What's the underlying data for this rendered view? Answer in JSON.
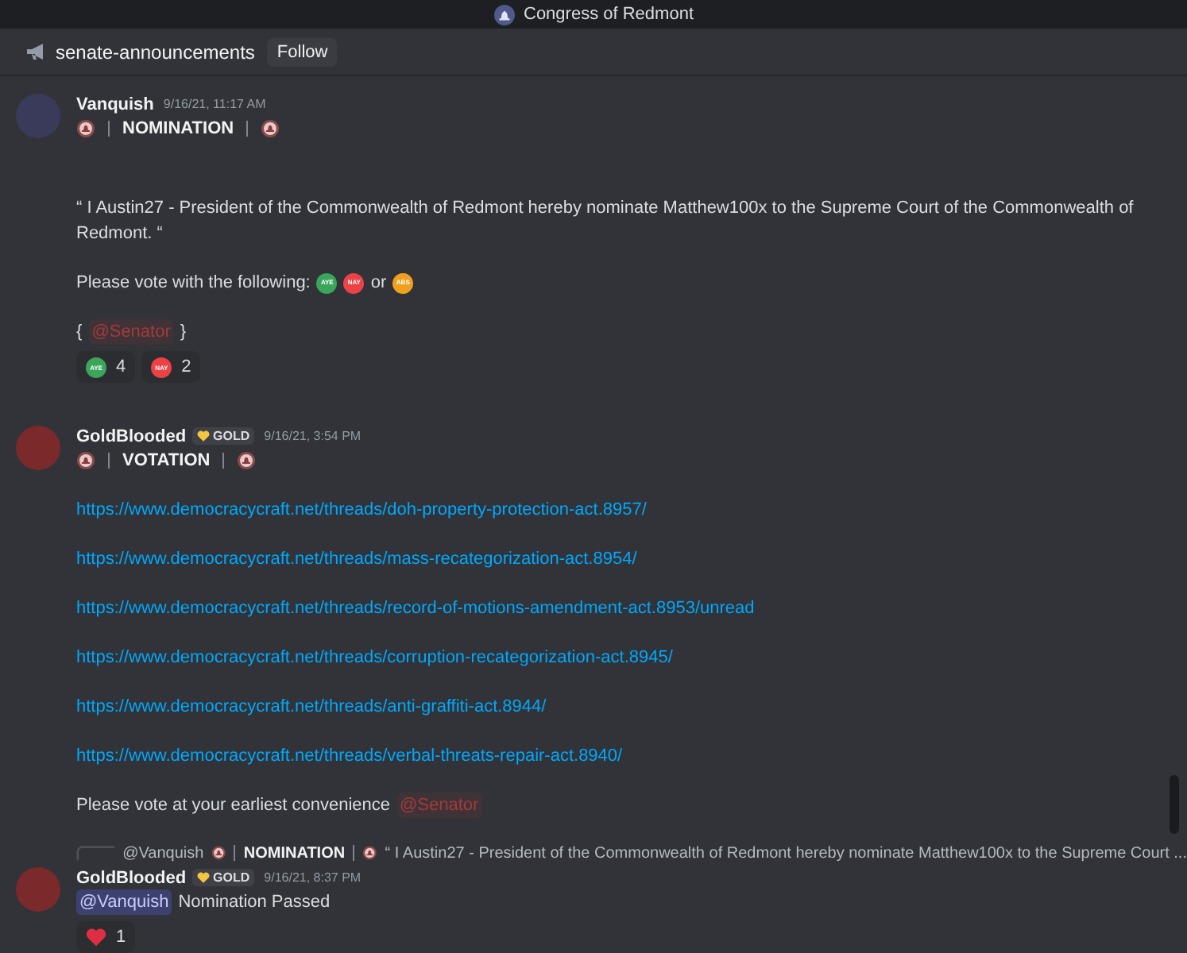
{
  "title": "Congress of Redmont",
  "channel": {
    "name": "senate-announcements",
    "follow": "Follow"
  },
  "messages": [
    {
      "author": "Vanquish",
      "time": "9/16/21, 11:17 AM",
      "heading": "NOMINATION",
      "blocks": [
        {
          "kind": "text",
          "text": "“ I Austin27 - President of the Commonwealth of Redmont hereby nominate Matthew100x to the Supreme Court of the Commonwealth of Redmont. “"
        },
        {
          "kind": "vote",
          "text": "Please vote with the following:",
          "joiner": "or",
          "options": [
            {
              "label": "AYE",
              "color": "#3ba55c"
            },
            {
              "label": "NAY",
              "color": "#ed4245"
            },
            {
              "label": "ABS",
              "color": "#f0a020"
            }
          ]
        },
        {
          "kind": "braced",
          "open": "{",
          "mention": "@Senator",
          "close": "}"
        }
      ],
      "reactions": [
        {
          "kind": "badge",
          "label": "AYE",
          "color": "#3ba55c",
          "count": "4"
        },
        {
          "kind": "badge",
          "label": "NAY",
          "color": "#ed4245",
          "count": "2"
        }
      ]
    },
    {
      "author": "GoldBlooded",
      "badge": "GOLD",
      "time": "9/16/21, 3:54 PM",
      "heading": "VOTATION",
      "blocks": [
        {
          "kind": "link",
          "text": "https://www.democracycraft.net/threads/doh-property-protection-act.8957/"
        },
        {
          "kind": "link",
          "text": "https://www.democracycraft.net/threads/mass-recategorization-act.8954/"
        },
        {
          "kind": "link",
          "text": "https://www.democracycraft.net/threads/record-of-motions-amendment-act.8953/unread"
        },
        {
          "kind": "link",
          "text": "https://www.democracycraft.net/threads/corruption-recategorization-act.8945/"
        },
        {
          "kind": "link",
          "text": "https://www.democracycraft.net/threads/anti-graffiti-act.8944/"
        },
        {
          "kind": "link",
          "text": "https://www.democracycraft.net/threads/verbal-threats-repair-act.8940/"
        },
        {
          "kind": "trailing",
          "text": "Please vote at your earliest convenience",
          "mention": "@Senator"
        }
      ]
    },
    {
      "author": "GoldBlooded",
      "badge": "GOLD",
      "time": "9/16/21, 8:37 PM",
      "reply": {
        "author": "@Vanquish",
        "heading": "NOMINATION",
        "excerpt": "“ I Austin27 - President of the Commonwealth of Redmont hereby nominate Matthew100x to the Supreme Court ..."
      },
      "blocks": [
        {
          "kind": "leading",
          "mention": "@Vanquish",
          "text": "Nomination Passed"
        }
      ],
      "reactions": [
        {
          "kind": "heart",
          "count": "1"
        }
      ]
    }
  ]
}
